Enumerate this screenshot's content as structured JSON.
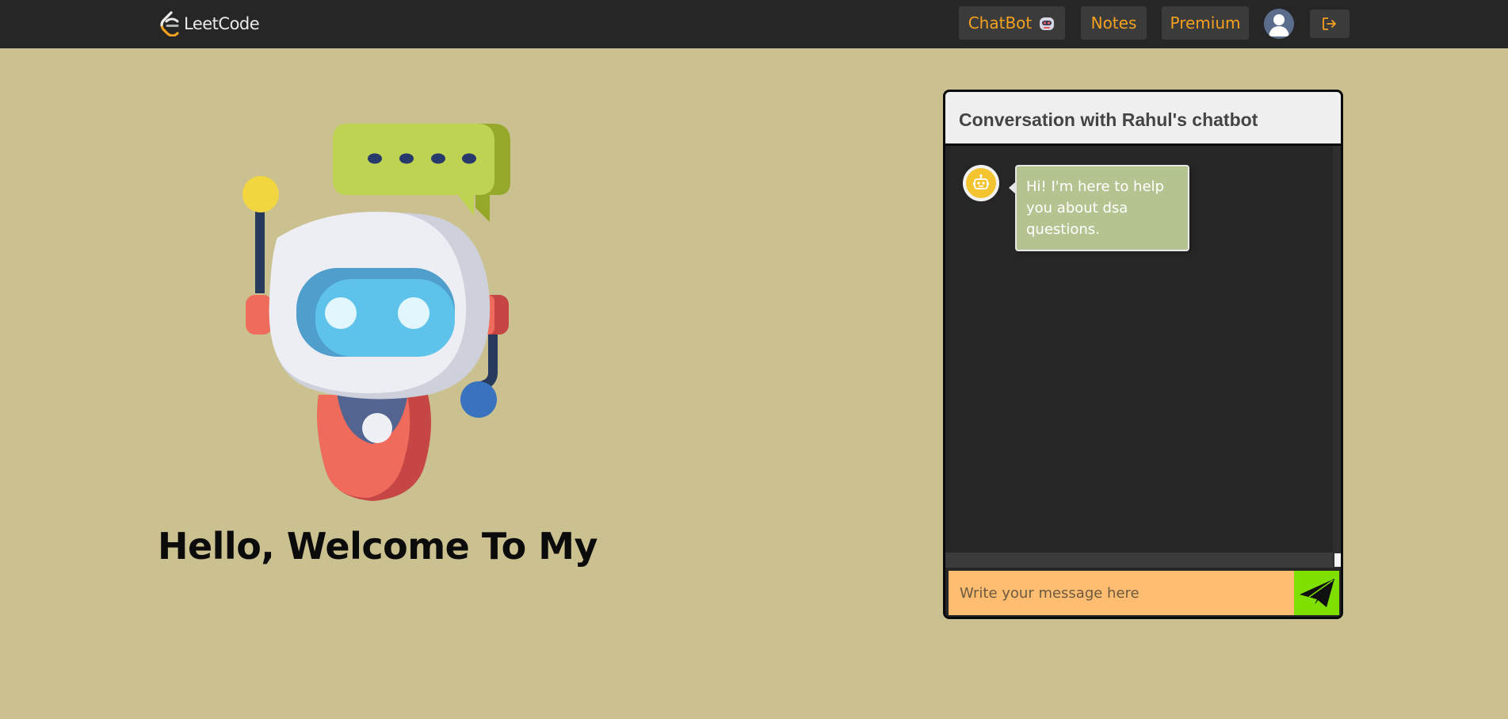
{
  "header": {
    "logo_text": "LeetCode",
    "nav": {
      "chatbot_label": "ChatBot",
      "notes_label": "Notes",
      "premium_label": "Premium"
    },
    "icons": {
      "logo": "leetcode-logo-icon",
      "chatbot": "robot-emoji-icon",
      "avatar": "user-avatar-icon",
      "logout": "logout-icon"
    }
  },
  "hero": {
    "welcome_text": "Hello, Welcome To My",
    "illustration": "robot-illustration"
  },
  "chat": {
    "title": "Conversation with Rahul's chatbot",
    "messages": [
      {
        "sender": "bot",
        "text": "Hi! I'm here to help you about dsa questions."
      }
    ],
    "input": {
      "placeholder": "Write your message here",
      "value": ""
    },
    "send_icon": "paper-plane-icon"
  },
  "colors": {
    "page_bg": "#cbc08f",
    "topbar_bg": "#262626",
    "nav_text": "#f4a11f",
    "chat_bg": "#262626",
    "bubble_bg": "#b5c391",
    "input_bg": "#ffbd71",
    "send_bg": "#7fe000"
  }
}
